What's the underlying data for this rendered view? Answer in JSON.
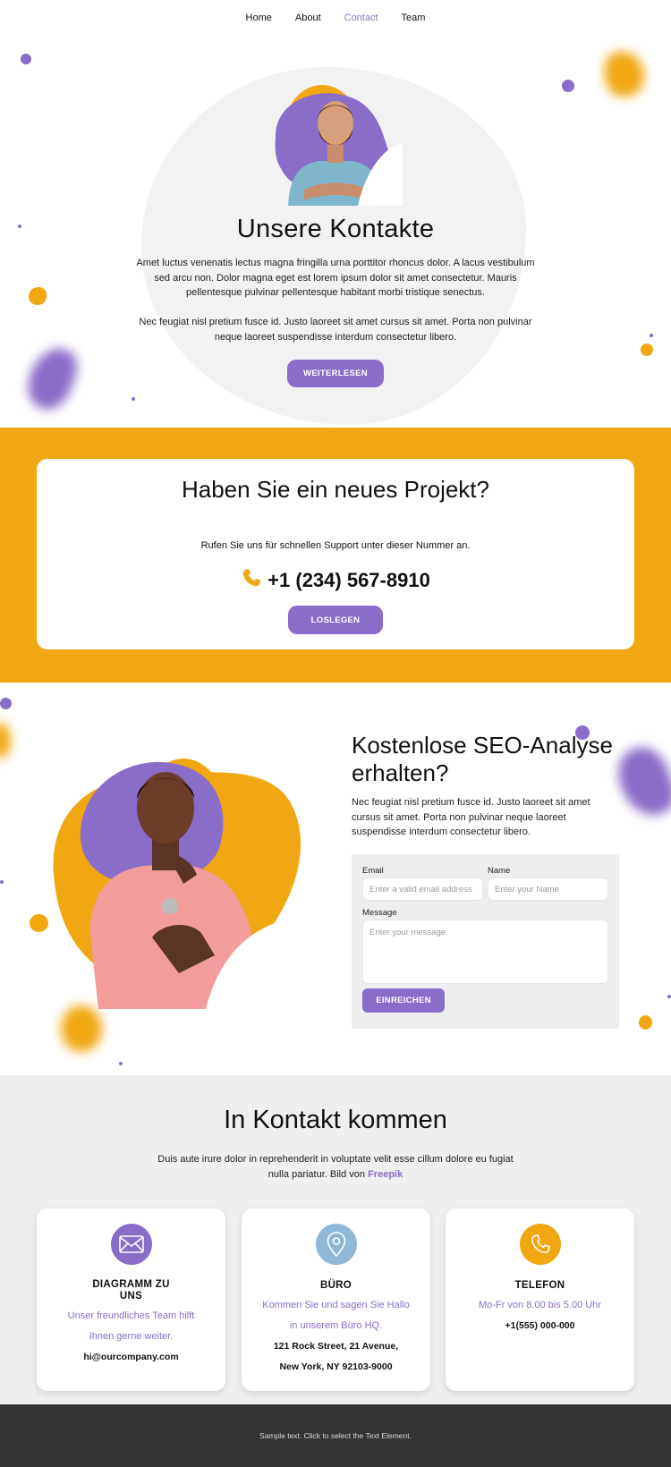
{
  "nav": {
    "items": [
      "Home",
      "About",
      "Contact",
      "Team"
    ],
    "active": "Contact"
  },
  "hero": {
    "title": "Unsere Kontakte",
    "p1": "Amet luctus venenatis lectus magna fringilla urna porttitor rhoncus dolor. A lacus vestibulum sed arcu non. Dolor magna eget est lorem ipsum dolor sit amet consectetur. Mauris pellentesque pulvinar pellentesque habitant morbi tristique senectus.",
    "p2": "Nec feugiat nisl pretium fusce id. Justo laoreet sit amet cursus sit amet. Porta non pulvinar neque laoreet suspendisse interdum consectetur libero.",
    "button": "WEITERLESEN"
  },
  "project": {
    "title": "Haben Sie ein neues Projekt?",
    "subtitle": "Rufen Sie uns für schnellen Support unter dieser Nummer an.",
    "phone": "+1 (234) 567-8910",
    "button": "LOSLEGEN"
  },
  "seo": {
    "title": "Kostenlose SEO-Analyse erhalten?",
    "text": "Nec feugiat nisl pretium fusce id. Justo laoreet sit amet cursus sit amet. Porta non pulvinar neque laoreet suspendisse interdum consectetur libero.",
    "form": {
      "email_label": "Email",
      "email_placeholder": "Enter a valid email address",
      "name_label": "Name",
      "name_placeholder": "Enter your Name",
      "message_label": "Message",
      "message_placeholder": "Enter your message",
      "submit": "EINREICHEN"
    }
  },
  "contact": {
    "title": "In Kontakt kommen",
    "text": "Duis aute irure dolor in reprehenderit in voluptate velit esse cillum dolore eu fugiat nulla pariatur. Bild von",
    "link": "Freepik",
    "cards": [
      {
        "icon": "mail-icon",
        "title": "DIAGRAMM ZU UNS",
        "purple_lines": [
          "Unser freundliches Team hilft",
          "Ihnen gerne weiter."
        ],
        "bold_lines": [
          "hi@ourcompany.com"
        ]
      },
      {
        "icon": "location-pin-icon",
        "title": "BÜRO",
        "purple_lines": [
          "Kommen Sie und sagen Sie Hallo",
          "in unserem Büro HQ."
        ],
        "bold_lines": [
          "121 Rock Street, 21 Avenue,",
          "New York, NY 92103-9000"
        ]
      },
      {
        "icon": "phone-icon",
        "title": "TELEFON",
        "purple_lines": [
          "Mo-Fr von 8.00 bis 5.00 Uhr"
        ],
        "bold_lines": [
          "+1(555) 000-000"
        ]
      }
    ]
  },
  "footer": {
    "text": "Sample text. Click to select the Text Element."
  },
  "colors": {
    "purple": "#8a6cc9",
    "orange": "#f0a712",
    "light_gray": "#efefef",
    "footer": "#333333",
    "pin_blue": "#8fb8d8"
  }
}
